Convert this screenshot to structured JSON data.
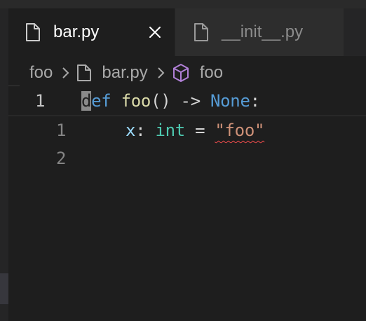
{
  "tabs": [
    {
      "label": "bar.py",
      "active": true,
      "icon": "file-icon"
    },
    {
      "label": "__init__.py",
      "active": false,
      "icon": "file-icon"
    }
  ],
  "breadcrumb": {
    "folder": "foo",
    "file": "bar.py",
    "symbol": "foo"
  },
  "editor": {
    "sticky": {
      "line_number": "1",
      "tokens": {
        "cursor_char": "d",
        "kw_rest": "ef",
        "space1": " ",
        "fn_name": "foo",
        "parens": "()",
        "arrow": " -> ",
        "return_type": "None",
        "colon": ":"
      }
    },
    "lines": [
      {
        "line_number": "1",
        "tokens": {
          "var": "x",
          "colon": ": ",
          "type": "int",
          "eq": " = ",
          "quote_open": "\"",
          "string": "foo",
          "quote_close": "\""
        }
      },
      {
        "line_number": "2"
      }
    ]
  },
  "colors": {
    "background": "#1e1e1e",
    "keyword": "#569cd6",
    "function": "#dcdcaa",
    "type": "#4ec9b0",
    "variable": "#9cdcfe",
    "string": "#ce9178",
    "error_squiggle": "#f14c4c",
    "symbol_icon": "#b180d7"
  }
}
